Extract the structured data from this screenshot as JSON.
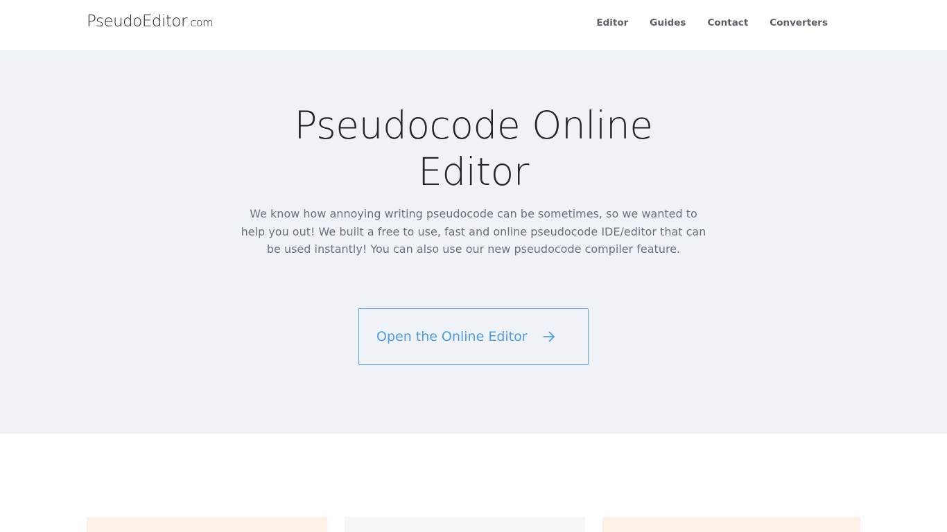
{
  "navbar": {
    "brand_main": "PseudoEditor",
    "brand_tld": ".com",
    "links": [
      {
        "label": "Editor"
      },
      {
        "label": "Guides"
      },
      {
        "label": "Contact"
      },
      {
        "label": "Converters"
      }
    ]
  },
  "hero": {
    "title": "Pseudocode Online Editor",
    "description": "We know how annoying writing pseudocode can be sometimes, so we wanted to help you out! We built a free to use, fast and online pseudocode IDE/editor that can be used instantly! You can also use our new pseudocode compiler feature.",
    "cta_label": "Open the Online Editor",
    "cta_icon": "arrow-right-icon"
  },
  "colors": {
    "hero_background": "#eff3f7",
    "accent": "#4f9ce6",
    "card_peach": "#fdf1e7",
    "card_gray": "#f6f7f9"
  }
}
